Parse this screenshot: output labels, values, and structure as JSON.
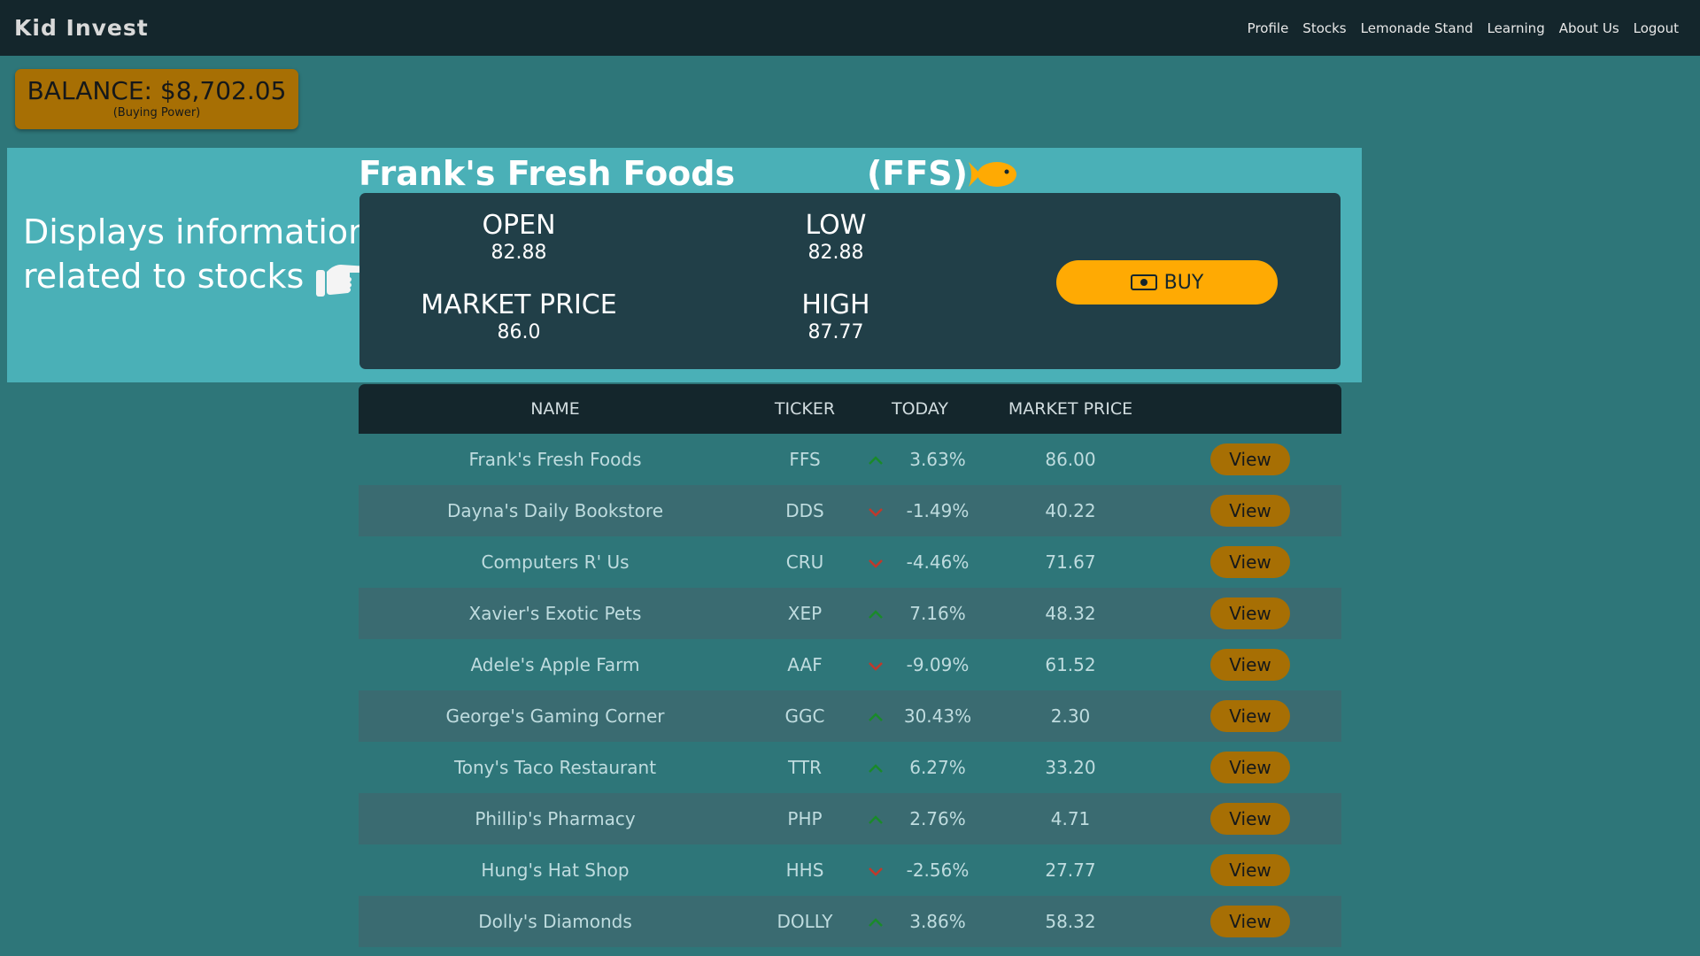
{
  "app": {
    "logo": "Kid Invest"
  },
  "nav": {
    "items": [
      "Profile",
      "Stocks",
      "Lemonade Stand",
      "Learning",
      "About Us",
      "Logout"
    ]
  },
  "balance": {
    "label": "BALANCE: $8,702.05",
    "sub": "(Buying Power)"
  },
  "hero": {
    "caption_line1": "Displays information",
    "caption_line2": "related to stocks",
    "stock_name": "Frank's Fresh Foods",
    "stock_ticker": "(FFS)",
    "icon": "fish-icon",
    "stats": {
      "open_label": "OPEN",
      "open_value": "82.88",
      "low_label": "LOW",
      "low_value": "82.88",
      "market_label": "MARKET PRICE",
      "market_value": "86.0",
      "high_label": "HIGH",
      "high_value": "87.77"
    },
    "buy_label": "BUY"
  },
  "table": {
    "headers": {
      "name": "NAME",
      "ticker": "TICKER",
      "today": "TODAY",
      "price": "MARKET PRICE"
    },
    "rows": [
      {
        "name": "Frank's Fresh Foods",
        "ticker": "FFS",
        "direction": "up",
        "today": "3.63%",
        "price": "86.00",
        "action": "View"
      },
      {
        "name": "Dayna's Daily Bookstore",
        "ticker": "DDS",
        "direction": "down",
        "today": "-1.49%",
        "price": "40.22",
        "action": "View"
      },
      {
        "name": "Computers R' Us",
        "ticker": "CRU",
        "direction": "down",
        "today": "-4.46%",
        "price": "71.67",
        "action": "View"
      },
      {
        "name": "Xavier's Exotic Pets",
        "ticker": "XEP",
        "direction": "up",
        "today": "7.16%",
        "price": "48.32",
        "action": "View"
      },
      {
        "name": "Adele's Apple Farm",
        "ticker": "AAF",
        "direction": "down",
        "today": "-9.09%",
        "price": "61.52",
        "action": "View"
      },
      {
        "name": "George's Gaming Corner",
        "ticker": "GGC",
        "direction": "up",
        "today": "30.43%",
        "price": "2.30",
        "action": "View"
      },
      {
        "name": "Tony's Taco Restaurant",
        "ticker": "TTR",
        "direction": "up",
        "today": "6.27%",
        "price": "33.20",
        "action": "View"
      },
      {
        "name": "Phillip's Pharmacy",
        "ticker": "PHP",
        "direction": "up",
        "today": "2.76%",
        "price": "4.71",
        "action": "View"
      },
      {
        "name": "Hung's Hat Shop",
        "ticker": "HHS",
        "direction": "down",
        "today": "-2.56%",
        "price": "27.77",
        "action": "View"
      },
      {
        "name": "Dolly's Diamonds",
        "ticker": "DOLLY",
        "direction": "up",
        "today": "3.86%",
        "price": "58.32",
        "action": "View"
      }
    ]
  },
  "colors": {
    "background": "#2e7679",
    "navbar": "#14262c",
    "accent": "#ffaa03",
    "view_button": "#a76f04",
    "up": "#1a8a2a",
    "down": "#c0392b"
  }
}
